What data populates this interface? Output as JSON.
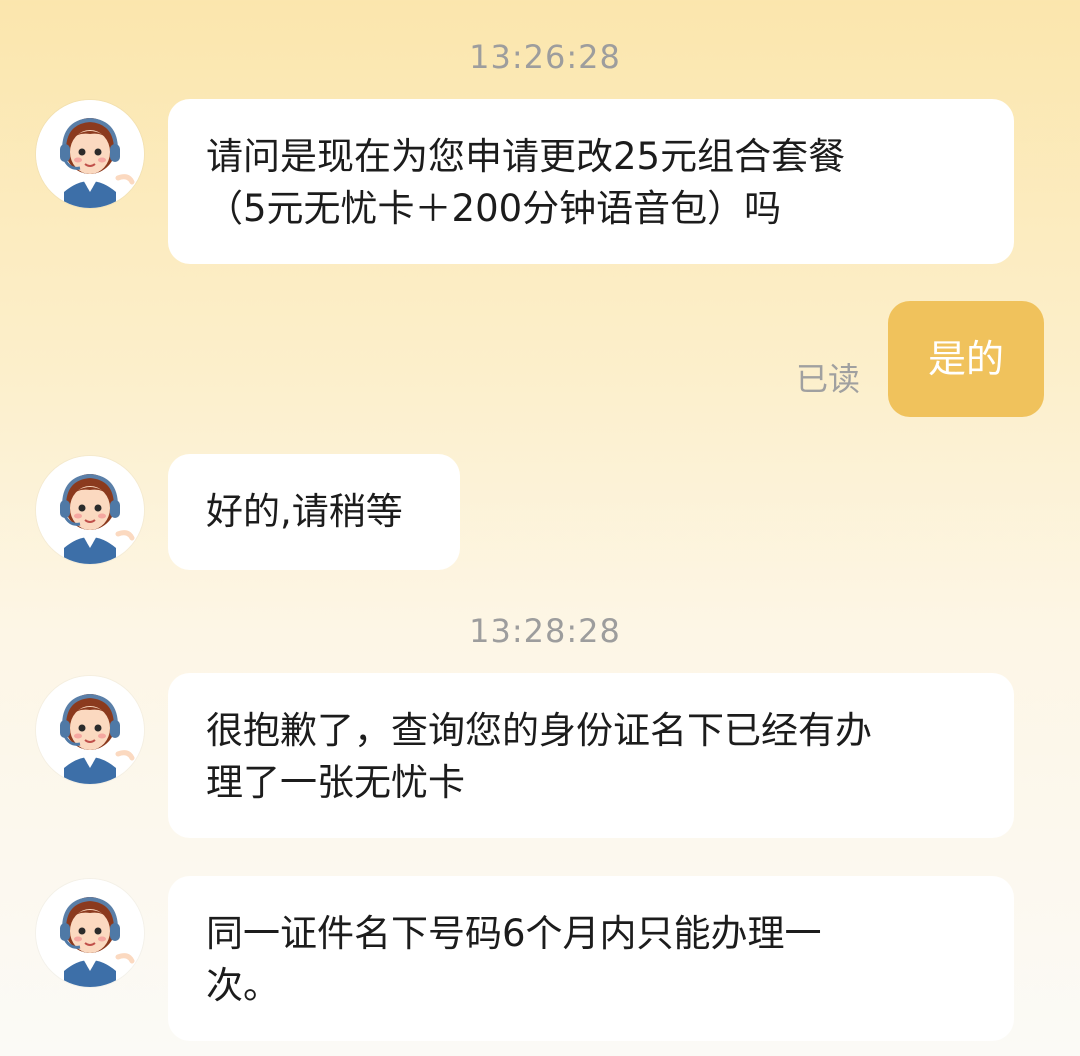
{
  "chat": {
    "timestamps": [
      "13:26:28",
      "13:28:28"
    ],
    "messages": [
      {
        "sender": "agent",
        "text": "请问是现在为您申请更改25元组合套餐\n（5元无忧卡＋200分钟语音包）吗"
      },
      {
        "sender": "me",
        "text": "是的",
        "status": "已读"
      },
      {
        "sender": "agent",
        "text": "好的,请稍等"
      },
      {
        "sender": "agent",
        "text": "很抱歉了，查询您的身份证名下已经有办\n理了一张无忧卡"
      },
      {
        "sender": "agent",
        "text": "同一证件名下号码6个月内只能办理一\n次。"
      }
    ]
  },
  "colors": {
    "bg_top": "#fbe6ad",
    "bg_bottom": "#fbfaf6",
    "my_bubble": "#f0c25c",
    "agent_bubble": "#ffffff",
    "timestamp_text": "#9d9d9d"
  },
  "icons": {
    "agent_avatar": "customer-service-agent-icon"
  }
}
